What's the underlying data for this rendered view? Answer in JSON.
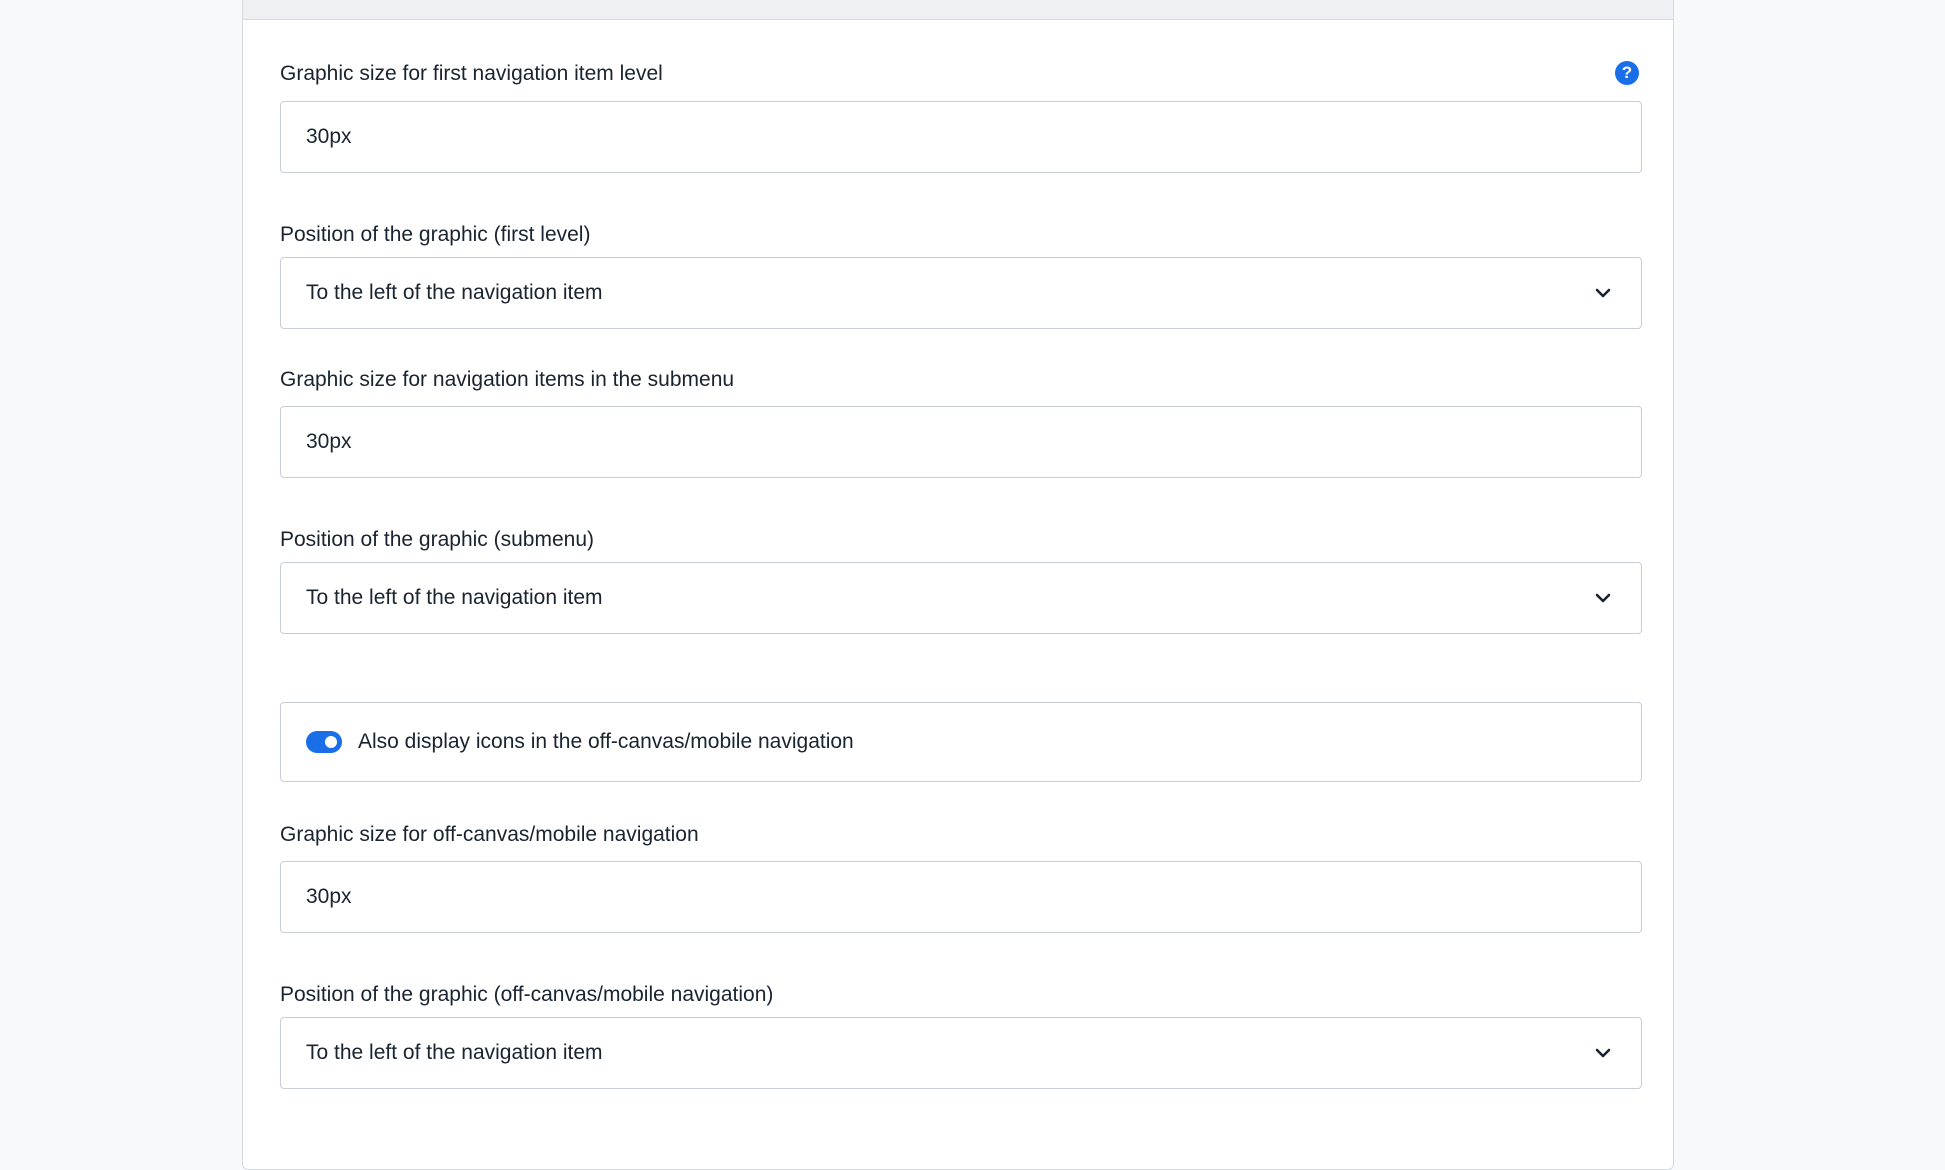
{
  "accent_color": "#1a6ee8",
  "fields": {
    "first_level_size": {
      "label": "Graphic size for first navigation item level",
      "value": "30px",
      "help_icon": "question-circle-icon"
    },
    "first_level_position": {
      "label": "Position of the graphic (first level)",
      "selected": "To the left of the navigation item"
    },
    "submenu_size": {
      "label": "Graphic size for navigation items in the submenu",
      "value": "30px"
    },
    "submenu_position": {
      "label": "Position of the graphic (submenu)",
      "selected": "To the left of the navigation item"
    },
    "offcanvas_toggle": {
      "label": "Also display icons in the off-canvas/mobile navigation",
      "checked": true
    },
    "offcanvas_size": {
      "label": "Graphic size for off-canvas/mobile navigation",
      "value": "30px"
    },
    "offcanvas_position": {
      "label": "Position of the graphic (off-canvas/mobile navigation)",
      "selected": "To the left of the navigation item"
    }
  }
}
